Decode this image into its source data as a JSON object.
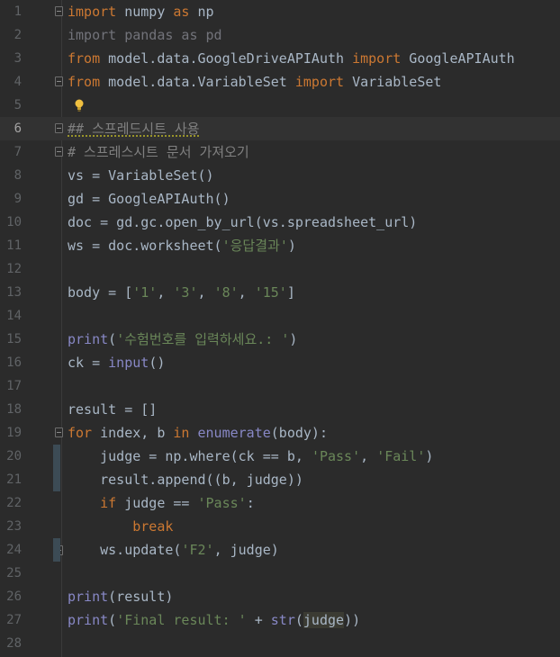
{
  "editor": {
    "current_line": 6,
    "colors": {
      "background": "#2b2b2b",
      "keyword": "#cc7832",
      "string": "#6a8759",
      "builtin": "#8888c6",
      "comment": "#808080",
      "text": "#a9b7c6",
      "line_number": "#606366"
    },
    "icons": [
      "lightbulb-icon",
      "fold-icon"
    ],
    "lines": [
      {
        "n": "1",
        "tokens": [
          {
            "t": "import",
            "c": "kw"
          },
          {
            "t": " numpy ",
            "c": ""
          },
          {
            "t": "as",
            "c": "kw"
          },
          {
            "t": " np",
            "c": ""
          }
        ]
      },
      {
        "n": "2",
        "tokens": [
          {
            "t": "import pandas as pd",
            "c": "unused"
          }
        ]
      },
      {
        "n": "3",
        "tokens": [
          {
            "t": "from",
            "c": "kw"
          },
          {
            "t": " model.data.GoogleDriveAPIAuth ",
            "c": ""
          },
          {
            "t": "import",
            "c": "kw"
          },
          {
            "t": " GoogleAPIAuth",
            "c": ""
          }
        ]
      },
      {
        "n": "4",
        "tokens": [
          {
            "t": "from",
            "c": "kw"
          },
          {
            "t": " model.data.VariableSet ",
            "c": ""
          },
          {
            "t": "import",
            "c": "kw"
          },
          {
            "t": " VariableSet",
            "c": ""
          }
        ]
      },
      {
        "n": "5",
        "tokens": []
      },
      {
        "n": "6",
        "tokens": [
          {
            "t": "## 스프레드시트 사용",
            "c": "cmt warn"
          }
        ]
      },
      {
        "n": "7",
        "tokens": [
          {
            "t": "# 스프레스시트 문서 가져오기",
            "c": "cmt"
          }
        ]
      },
      {
        "n": "8",
        "tokens": [
          {
            "t": "vs = VariableSet()",
            "c": ""
          }
        ]
      },
      {
        "n": "9",
        "tokens": [
          {
            "t": "gd = GoogleAPIAuth()",
            "c": ""
          }
        ]
      },
      {
        "n": "10",
        "tokens": [
          {
            "t": "doc = gd.gc.open_by_url(vs.spreadsheet_url)",
            "c": ""
          }
        ]
      },
      {
        "n": "11",
        "tokens": [
          {
            "t": "ws = doc.worksheet(",
            "c": ""
          },
          {
            "t": "'응답결과'",
            "c": "str"
          },
          {
            "t": ")",
            "c": ""
          }
        ]
      },
      {
        "n": "12",
        "tokens": []
      },
      {
        "n": "13",
        "tokens": [
          {
            "t": "body = [",
            "c": ""
          },
          {
            "t": "'1'",
            "c": "str"
          },
          {
            "t": ", ",
            "c": ""
          },
          {
            "t": "'3'",
            "c": "str"
          },
          {
            "t": ", ",
            "c": ""
          },
          {
            "t": "'8'",
            "c": "str"
          },
          {
            "t": ", ",
            "c": ""
          },
          {
            "t": "'15'",
            "c": "str"
          },
          {
            "t": "]",
            "c": ""
          }
        ]
      },
      {
        "n": "14",
        "tokens": []
      },
      {
        "n": "15",
        "tokens": [
          {
            "t": "print",
            "c": "fn"
          },
          {
            "t": "(",
            "c": ""
          },
          {
            "t": "'수험번호를 입력하세요.: '",
            "c": "str"
          },
          {
            "t": ")",
            "c": ""
          }
        ]
      },
      {
        "n": "16",
        "tokens": [
          {
            "t": "ck = ",
            "c": ""
          },
          {
            "t": "input",
            "c": "fn"
          },
          {
            "t": "()",
            "c": ""
          }
        ]
      },
      {
        "n": "17",
        "tokens": []
      },
      {
        "n": "18",
        "tokens": [
          {
            "t": "result = []",
            "c": ""
          }
        ]
      },
      {
        "n": "19",
        "tokens": [
          {
            "t": "for",
            "c": "kw"
          },
          {
            "t": " index, b ",
            "c": ""
          },
          {
            "t": "in",
            "c": "kw"
          },
          {
            "t": " ",
            "c": ""
          },
          {
            "t": "enumerate",
            "c": "fn"
          },
          {
            "t": "(body):",
            "c": ""
          }
        ]
      },
      {
        "n": "20",
        "tokens": [
          {
            "t": "    judge = np.where(ck == b, ",
            "c": ""
          },
          {
            "t": "'Pass'",
            "c": "str"
          },
          {
            "t": ", ",
            "c": ""
          },
          {
            "t": "'Fail'",
            "c": "str"
          },
          {
            "t": ")",
            "c": ""
          }
        ]
      },
      {
        "n": "21",
        "tokens": [
          {
            "t": "    result.append((b, judge))",
            "c": ""
          }
        ]
      },
      {
        "n": "22",
        "tokens": [
          {
            "t": "    ",
            "c": ""
          },
          {
            "t": "if",
            "c": "kw"
          },
          {
            "t": " judge == ",
            "c": ""
          },
          {
            "t": "'Pass'",
            "c": "str"
          },
          {
            "t": ":",
            "c": ""
          }
        ]
      },
      {
        "n": "23",
        "tokens": [
          {
            "t": "        ",
            "c": ""
          },
          {
            "t": "break",
            "c": "kw"
          }
        ]
      },
      {
        "n": "24",
        "tokens": [
          {
            "t": "    ws.update(",
            "c": ""
          },
          {
            "t": "'F2'",
            "c": "str"
          },
          {
            "t": ", judge)",
            "c": ""
          }
        ]
      },
      {
        "n": "25",
        "tokens": []
      },
      {
        "n": "26",
        "tokens": [
          {
            "t": "print",
            "c": "fn"
          },
          {
            "t": "(result)",
            "c": ""
          }
        ]
      },
      {
        "n": "27",
        "tokens": [
          {
            "t": "print",
            "c": "fn"
          },
          {
            "t": "(",
            "c": ""
          },
          {
            "t": "'Final result: '",
            "c": "str"
          },
          {
            "t": " + ",
            "c": ""
          },
          {
            "t": "str",
            "c": "fn"
          },
          {
            "t": "(",
            "c": ""
          },
          {
            "t": "judge",
            "c": "hl"
          },
          {
            "t": "))",
            "c": ""
          }
        ]
      },
      {
        "n": "28",
        "tokens": []
      }
    ]
  }
}
